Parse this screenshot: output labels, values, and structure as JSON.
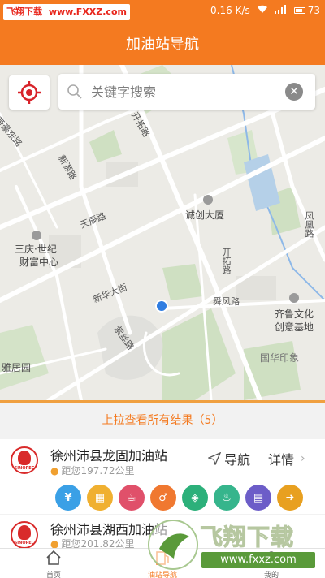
{
  "status_bar": {
    "watermark_left": "飞翔下载",
    "watermark_url": "www.FXXZ.com",
    "speed": "0.16 K/s",
    "battery": "73"
  },
  "header": {
    "title": "加油站导航"
  },
  "search": {
    "placeholder": "关键字搜索"
  },
  "map_labels": {
    "road_1": "帝豪东路",
    "road_2": "开拓路",
    "road_3": "新源路",
    "road_4": "天辰路",
    "road_5": "诚创大厦",
    "road_6": "凤凰路",
    "road_7": "三庆·世纪",
    "road_8": "财富中心",
    "road_9": "开拓路",
    "road_10": "新华大街",
    "road_11": "舜风路",
    "road_12": "齐鲁文化",
    "road_13": "创意基地",
    "road_14": "紫丝路",
    "road_15": "国华印象",
    "road_16": "雅居园"
  },
  "pull_up": {
    "text": "上拉查看所有结果（5）"
  },
  "stations": [
    {
      "name": "徐州沛县龙固加油站",
      "distance": "距您197.72公里",
      "nav_label": "导航",
      "detail_label": "详情",
      "logo_text": "SINOPEC"
    },
    {
      "name": "徐州沛县湖西加油站",
      "distance": "距您201.82公里",
      "logo_text": "SINOPEC"
    }
  ],
  "services": [
    {
      "icon": "atm-icon",
      "color": "#3aa0e6",
      "glyph": "¥"
    },
    {
      "icon": "store-icon",
      "color": "#f0b030",
      "glyph": "▦"
    },
    {
      "icon": "coffee-icon",
      "color": "#e0506a",
      "glyph": "☕"
    },
    {
      "icon": "restroom-icon",
      "color": "#f07830",
      "glyph": "♂"
    },
    {
      "icon": "car-service-icon",
      "color": "#2cb07a",
      "glyph": "◈"
    },
    {
      "icon": "car-wash-icon",
      "color": "#36b58c",
      "glyph": "♨"
    },
    {
      "icon": "lodging-icon",
      "color": "#6c5dc8",
      "glyph": "▤"
    },
    {
      "icon": "more-icon",
      "color": "#e8a020",
      "glyph": "➜"
    }
  ],
  "tabbar": {
    "home": "首页",
    "nav": "油站导航",
    "mine": "我的"
  },
  "watermark": {
    "title": "飞翔下载",
    "url": "www.fxxz.com"
  },
  "colors": {
    "brand_orange": "#f47a20",
    "map_bg": "#ecebe6"
  }
}
